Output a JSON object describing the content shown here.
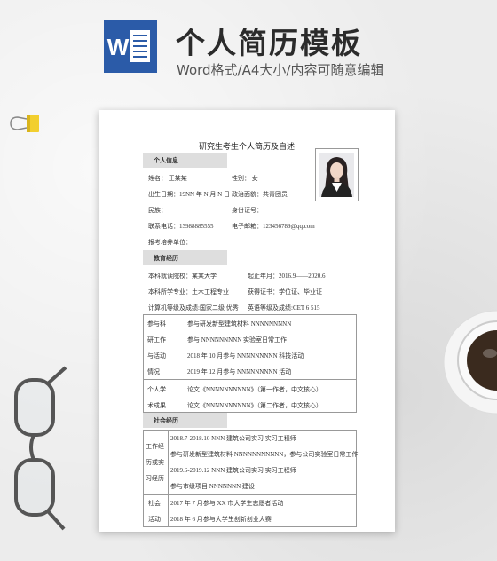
{
  "banner": {
    "title": "个人简历模板",
    "subtitle": "Word格式/A4大小/内容可随意编辑",
    "logo_letter": "W"
  },
  "doc": {
    "title": "研究生考生个人简历及自述",
    "sections": {
      "personal": "个人信息",
      "education": "教育经历",
      "social": "社会经历"
    },
    "personal": {
      "name": "姓名：      王某某",
      "gender": "性别：        女",
      "birth": "出生日期：19NN 年 N 月 N 日",
      "politics": "政治面貌：共青团员",
      "ethnicity": "民族：",
      "id": "身份证号：",
      "phone": "联系电话：13988885555",
      "email": "电子邮箱：123456789@qq.com",
      "applied_unit": "报考培养单位："
    },
    "education": {
      "school": "本科就读院校：某某大学",
      "period": "起止年月：2016.9——2020.6",
      "major": "本科所学专业：土木工程专业",
      "certificate": "获得证书：学位证、毕业证",
      "computer": "计算机等级及成绩:国家二级      优秀",
      "english": "英语等级及成绩:CET 6    515"
    },
    "research": {
      "label_lines": [
        "参与科",
        "研工作",
        "与活动",
        "情况"
      ],
      "items": [
        "参与研发新型建筑材料 NNNNNNNNN",
        "参与 NNNNNNNNN 实验室日常工作",
        "2018 年 10 月参与 NNNNNNNNN 科技活动",
        "2019 年 12 月参与 NNNNNNNNN 活动"
      ]
    },
    "papers": {
      "label_lines": [
        "个人学",
        "术成果"
      ],
      "items": [
        "论文《NNNNNNNNNN》（第一作者，中文核心）",
        "论文《NNNNNNNNNN》（第二作者，中文核心）"
      ]
    },
    "work": {
      "label_lines": [
        "工作经",
        "历或实",
        "习经历"
      ],
      "items": [
        "2018.7-2018.10    NNN 建筑公司实习        实习工程师",
        "参与研发新型建筑材料 NNNNNNNNNNN，参与公司实验室日常工作",
        "2019.6-2019.12    NNN 建筑公司实习        实习工程师",
        "参与市级项目 NNNNNNN 建设"
      ]
    },
    "social_activity": {
      "label_lines": [
        "社会",
        "活动"
      ],
      "items": [
        "2017 年 7 月参与 XX 市大学生志愿者活动",
        "2018 年 6 月参与大学生创新创业大赛"
      ]
    }
  }
}
